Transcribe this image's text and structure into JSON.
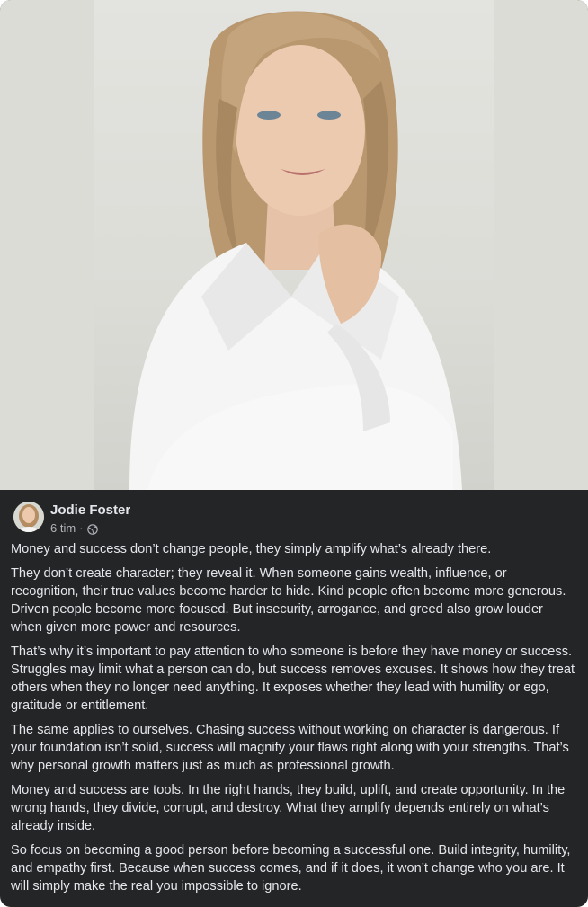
{
  "post": {
    "author": "Jodie Foster",
    "timestamp": "6 tim",
    "separator": "·",
    "privacy_icon": "globe-icon",
    "paragraphs": [
      "Money and success don’t change people, they simply amplify what’s already there.",
      "They don’t create character; they reveal it. When someone gains wealth, influence, or recognition, their true values become harder to hide. Kind people often become more generous. Driven people become more focused. But insecurity, arrogance, and greed also grow louder when given more power and resources.",
      "That’s why it’s important to pay attention to who someone is before they have money or success. Struggles may limit what a person can do, but success removes excuses. It shows how they treat others when they no longer need anything. It exposes whether they lead with humility or ego, gratitude or entitlement.",
      "The same applies to ourselves. Chasing success without working on character is dangerous. If your foundation isn’t solid, success will magnify your flaws right along with your strengths. That’s why personal growth matters just as much as professional growth.",
      "Money and success are tools. In the right hands, they build, uplift, and create opportunity. In the wrong hands, they divide, corrupt, and destroy. What they amplify depends entirely on what’s already inside.",
      "So focus on becoming a good person before becoming a successful one. Build integrity, humility, and empathy first. Because when success comes, and if it does, it won’t change who you are. It will simply make the real you impossible to ignore."
    ]
  },
  "colors": {
    "card_background": "#242526",
    "primary_text": "#e4e6eb",
    "secondary_text": "#b0b3b8"
  }
}
